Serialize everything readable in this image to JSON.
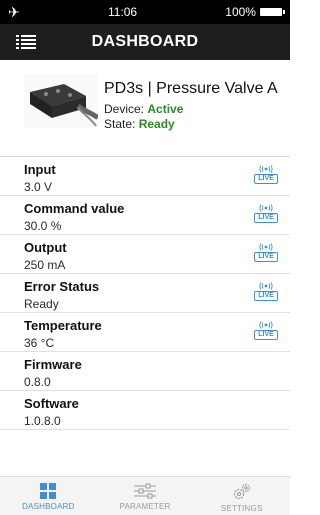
{
  "status_bar": {
    "time": "11:06",
    "battery": "100%",
    "icons": [
      "airplane-icon",
      "battery-icon"
    ]
  },
  "header": {
    "title": "DASHBOARD",
    "menu_icon": "hamburger-menu-icon"
  },
  "device": {
    "name": "PD3s | Pressure Valve A",
    "device_label": "Device:",
    "device_status": "Active",
    "state_label": "State:",
    "state_value": "Ready",
    "image_icon": "valve-device-image",
    "status_color": "#2a8a27"
  },
  "params": [
    {
      "label": "Input",
      "value": "3.0 V",
      "live": true
    },
    {
      "label": "Command value",
      "value": "30.0 %",
      "live": true
    },
    {
      "label": "Output",
      "value": "250 mA",
      "live": true
    },
    {
      "label": "Error Status",
      "value": "Ready",
      "live": true
    },
    {
      "label": "Temperature",
      "value": "36 °C",
      "live": true
    },
    {
      "label": "Firmware",
      "value": "0.8.0",
      "live": false
    },
    {
      "label": "Software",
      "value": "1.0.8.0",
      "live": false
    }
  ],
  "live_badge": "LIVE",
  "tabs": [
    {
      "label": "DASHBOARD",
      "icon": "dashboard-grid-icon",
      "active": true
    },
    {
      "label": "PARAMETER",
      "icon": "sliders-icon",
      "active": false
    },
    {
      "label": "SETTINGS",
      "icon": "gears-icon",
      "active": false
    }
  ],
  "colors": {
    "accent": "#3e8fd6",
    "header_bg": "#1e1e1e",
    "status_green": "#2a8a27"
  }
}
